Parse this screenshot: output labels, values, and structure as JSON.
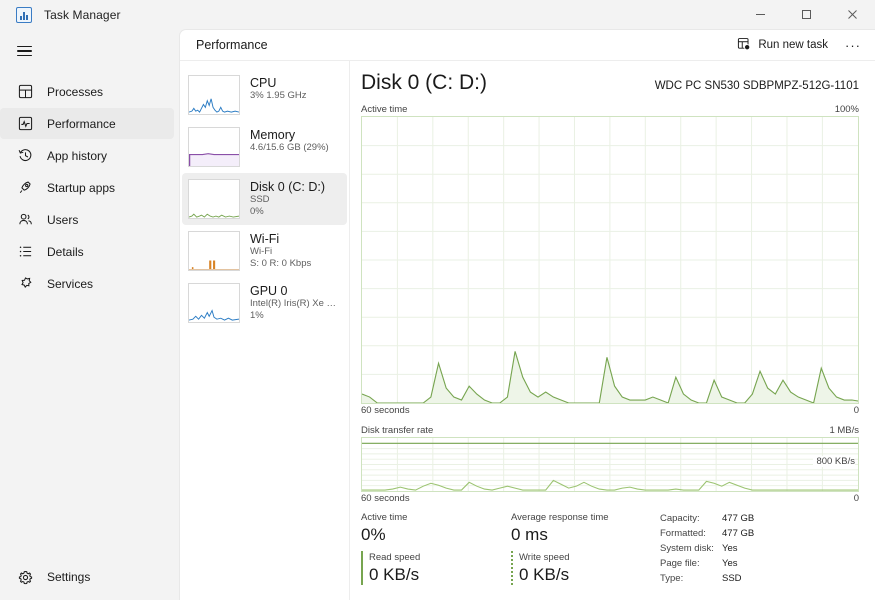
{
  "window": {
    "title": "Task Manager",
    "icon": "task-manager-icon",
    "minimize": "minimize",
    "maximize": "maximize",
    "close": "close"
  },
  "nav": {
    "hamburger": "navigation-menu",
    "items": [
      {
        "label": "Processes",
        "icon": "processes-icon",
        "active": false
      },
      {
        "label": "Performance",
        "icon": "performance-icon",
        "active": true
      },
      {
        "label": "App history",
        "icon": "app-history-icon",
        "active": false
      },
      {
        "label": "Startup apps",
        "icon": "startup-apps-icon",
        "active": false
      },
      {
        "label": "Users",
        "icon": "users-icon",
        "active": false
      },
      {
        "label": "Details",
        "icon": "details-icon",
        "active": false
      },
      {
        "label": "Services",
        "icon": "services-icon",
        "active": false
      }
    ],
    "settings": {
      "label": "Settings",
      "icon": "gear-icon"
    }
  },
  "commandbar": {
    "title": "Performance",
    "run_new_task": "Run new task",
    "run_new_task_icon": "run-new-task-icon",
    "more_label": "···"
  },
  "perf_list": [
    {
      "name": "CPU",
      "line1": "3%  1.95 GHz",
      "line2": "",
      "color": "#2b7cc4",
      "active": false
    },
    {
      "name": "Memory",
      "line1": "4.6/15.6 GB (29%)",
      "line2": "",
      "color": "#8a4fa8",
      "active": false
    },
    {
      "name": "Disk 0 (C: D:)",
      "line1": "SSD",
      "line2": "0%",
      "color": "#77a550",
      "active": true
    },
    {
      "name": "Wi-Fi",
      "line1": "Wi-Fi",
      "line2": "S: 0 R: 0 Kbps",
      "color": "#d98324",
      "active": false
    },
    {
      "name": "GPU 0",
      "line1": "Intel(R) Iris(R) Xe G…",
      "line2": "1%",
      "color": "#2b7cc4",
      "active": false
    }
  ],
  "detail": {
    "title": "Disk 0 (C: D:)",
    "model": "WDC PC SN530 SDBPMPZ-512G-1101",
    "graph1": {
      "label": "Active time",
      "max": "100%",
      "x_left": "60 seconds",
      "x_right": "0"
    },
    "graph2": {
      "label": "Disk transfer rate",
      "max": "1 MB/s",
      "marker": "800 KB/s",
      "x_left": "60 seconds",
      "x_right": "0"
    }
  },
  "stats": {
    "active_time": {
      "caption": "Active time",
      "value": "0%"
    },
    "avg_response": {
      "caption": "Average response time",
      "value": "0 ms"
    },
    "read_speed": {
      "caption": "Read speed",
      "value": "0 KB/s"
    },
    "write_speed": {
      "caption": "Write speed",
      "value": "0 KB/s"
    },
    "info": [
      {
        "key": "Capacity:",
        "value": "477 GB"
      },
      {
        "key": "Formatted:",
        "value": "477 GB"
      },
      {
        "key": "System disk:",
        "value": "Yes"
      },
      {
        "key": "Page file:",
        "value": "Yes"
      },
      {
        "key": "Type:",
        "value": "SSD"
      }
    ]
  },
  "chart_data": [
    {
      "type": "area",
      "title": "Active time",
      "ylabel": "Active time",
      "xlabel": "60 seconds",
      "ylim": [
        0,
        100
      ],
      "xlim": [
        60,
        0
      ],
      "grid": true,
      "y_max_label": "100%",
      "y_min_label": "0",
      "color": "#77a550",
      "values": [
        3,
        1,
        0,
        0,
        0,
        0,
        0,
        0,
        0,
        2,
        14,
        5,
        2,
        1,
        6,
        3,
        1,
        0,
        0,
        2,
        18,
        9,
        4,
        2,
        4,
        2,
        1,
        0,
        0,
        0,
        0,
        0,
        16,
        6,
        2,
        1,
        1,
        1,
        2,
        1,
        0,
        9,
        3,
        1,
        0,
        0,
        8,
        2,
        1,
        0,
        0,
        3,
        11,
        5,
        3,
        6,
        4,
        2,
        1,
        0,
        12,
        5,
        2,
        1,
        1
      ]
    },
    {
      "type": "area",
      "title": "Disk transfer rate",
      "ylabel": "Disk transfer rate",
      "xlabel": "60 seconds",
      "ylim": [
        0,
        1000
      ],
      "xlim": [
        60,
        0
      ],
      "grid": true,
      "y_max_label": "1 MB/s",
      "y_marker_label": "800 KB/s",
      "y_min_label": "0",
      "color": "#77a550",
      "values": [
        0,
        0,
        0,
        0,
        10,
        40,
        20,
        10,
        60,
        110,
        70,
        30,
        10,
        10,
        120,
        60,
        20,
        10,
        40,
        60,
        30,
        10,
        5,
        5,
        10,
        200,
        90,
        30,
        60,
        130,
        60,
        20,
        10,
        5,
        30,
        40,
        20,
        10,
        5,
        5,
        10,
        20,
        10,
        5,
        5,
        160,
        110,
        60,
        120,
        70,
        30,
        10,
        5,
        5,
        5,
        5,
        5,
        5,
        5,
        5,
        5,
        5,
        5,
        5,
        5
      ]
    }
  ]
}
